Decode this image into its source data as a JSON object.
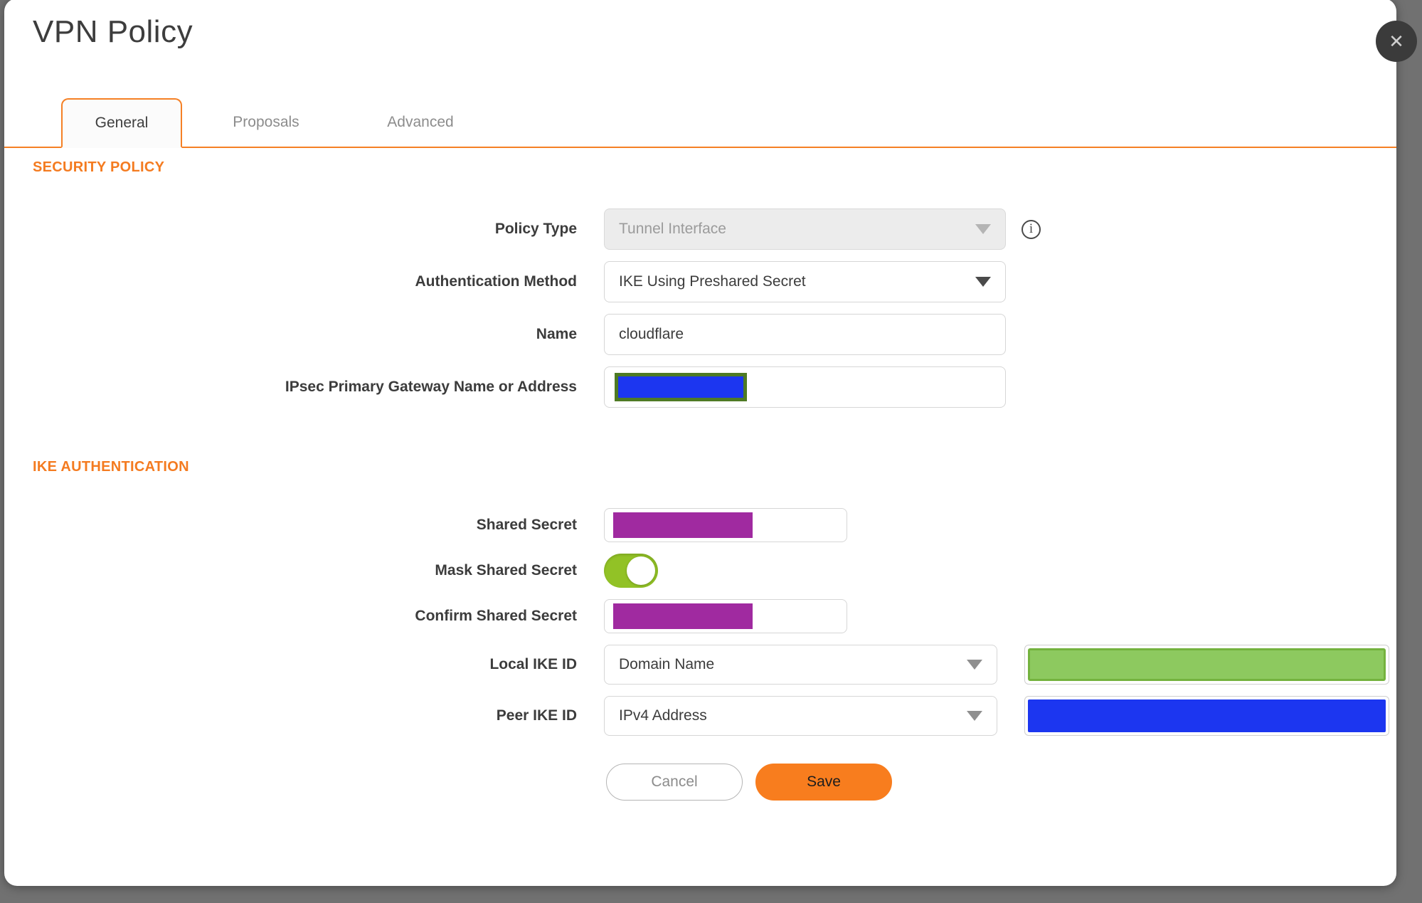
{
  "dialog": {
    "title": "VPN Policy",
    "close_icon": "✕"
  },
  "tabs": [
    {
      "label": "General",
      "active": true
    },
    {
      "label": "Proposals",
      "active": false
    },
    {
      "label": "Advanced",
      "active": false
    }
  ],
  "security_policy": {
    "heading": "SECURITY POLICY",
    "policy_type": {
      "label": "Policy Type",
      "value": "Tunnel Interface",
      "disabled": true
    },
    "auth_method": {
      "label": "Authentication Method",
      "value": "IKE Using Preshared Secret"
    },
    "name": {
      "label": "Name",
      "value": "cloudflare"
    },
    "gateway": {
      "label": "IPsec Primary Gateway Name or Address",
      "value_redacted": true
    }
  },
  "ike_authentication": {
    "heading": "IKE AUTHENTICATION",
    "shared_secret": {
      "label": "Shared Secret",
      "value_redacted": true
    },
    "mask_shared_secret": {
      "label": "Mask Shared Secret",
      "state": "on"
    },
    "confirm_shared_secret": {
      "label": "Confirm Shared Secret",
      "value_redacted": true
    },
    "local_ike_id": {
      "label": "Local IKE ID",
      "value": "Domain Name",
      "id_value_redacted": true
    },
    "peer_ike_id": {
      "label": "Peer IKE ID",
      "value": "IPv4 Address",
      "id_value_redacted": true
    }
  },
  "buttons": {
    "cancel": "Cancel",
    "save": "Save"
  },
  "colors": {
    "accent_orange": "#f47b20",
    "tab_border_orange": "#f58025",
    "save_button_orange": "#f87d1e",
    "toggle_green": "#92c226",
    "redaction_blue": "#1c36f0",
    "redaction_purple": "#a02aa0",
    "redaction_green_fill": "#8dc95f",
    "redaction_green_border": "#74b23e",
    "redaction_olive_border": "#4e7a24",
    "backdrop_gray": "#717171"
  }
}
